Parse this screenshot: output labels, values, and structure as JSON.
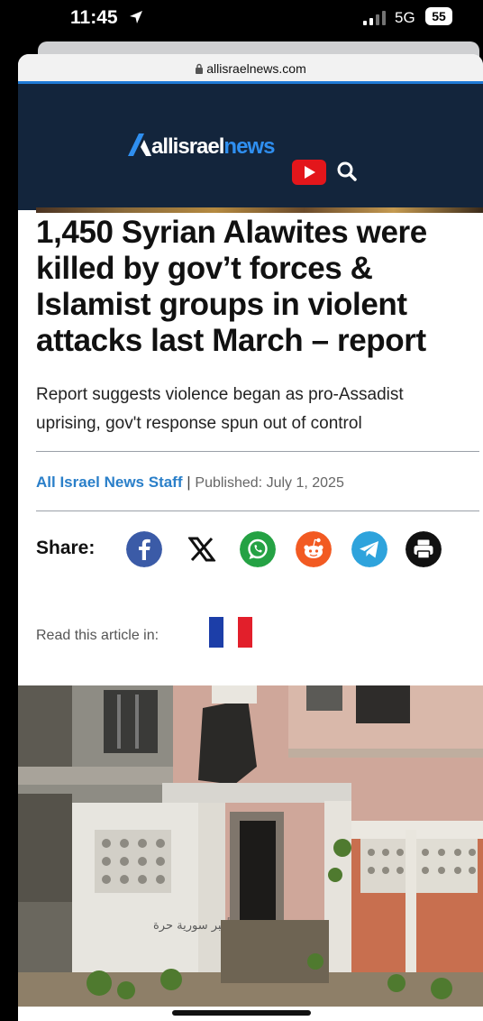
{
  "status": {
    "time": "11:45",
    "network": "5G",
    "battery": "55"
  },
  "browser": {
    "url": "allisraelnews.com"
  },
  "site": {
    "logo_left": "allisrael",
    "logo_right": "news",
    "brand_blue": "#2f8ff0",
    "header_bg": "#13253c"
  },
  "article": {
    "headline": "1,450 Syrian Alawites were killed by gov’t forces & Islamist groups in violent attacks last March – report",
    "subheadline": "Report suggests violence began as pro-Assadist uprising, gov't response spun out of control",
    "author": "All Israel News Staff",
    "separator": "|",
    "published": "Published: July 1, 2025"
  },
  "share": {
    "label": "Share:",
    "icons": [
      "facebook-icon",
      "x-icon",
      "whatsapp-icon",
      "reddit-icon",
      "telegram-icon",
      "print-icon"
    ]
  },
  "translate": {
    "label": "Read this article in:",
    "flag": "french-flag-icon"
  },
  "photo": {
    "graffiti": "الله أكبر سورية حرة"
  }
}
